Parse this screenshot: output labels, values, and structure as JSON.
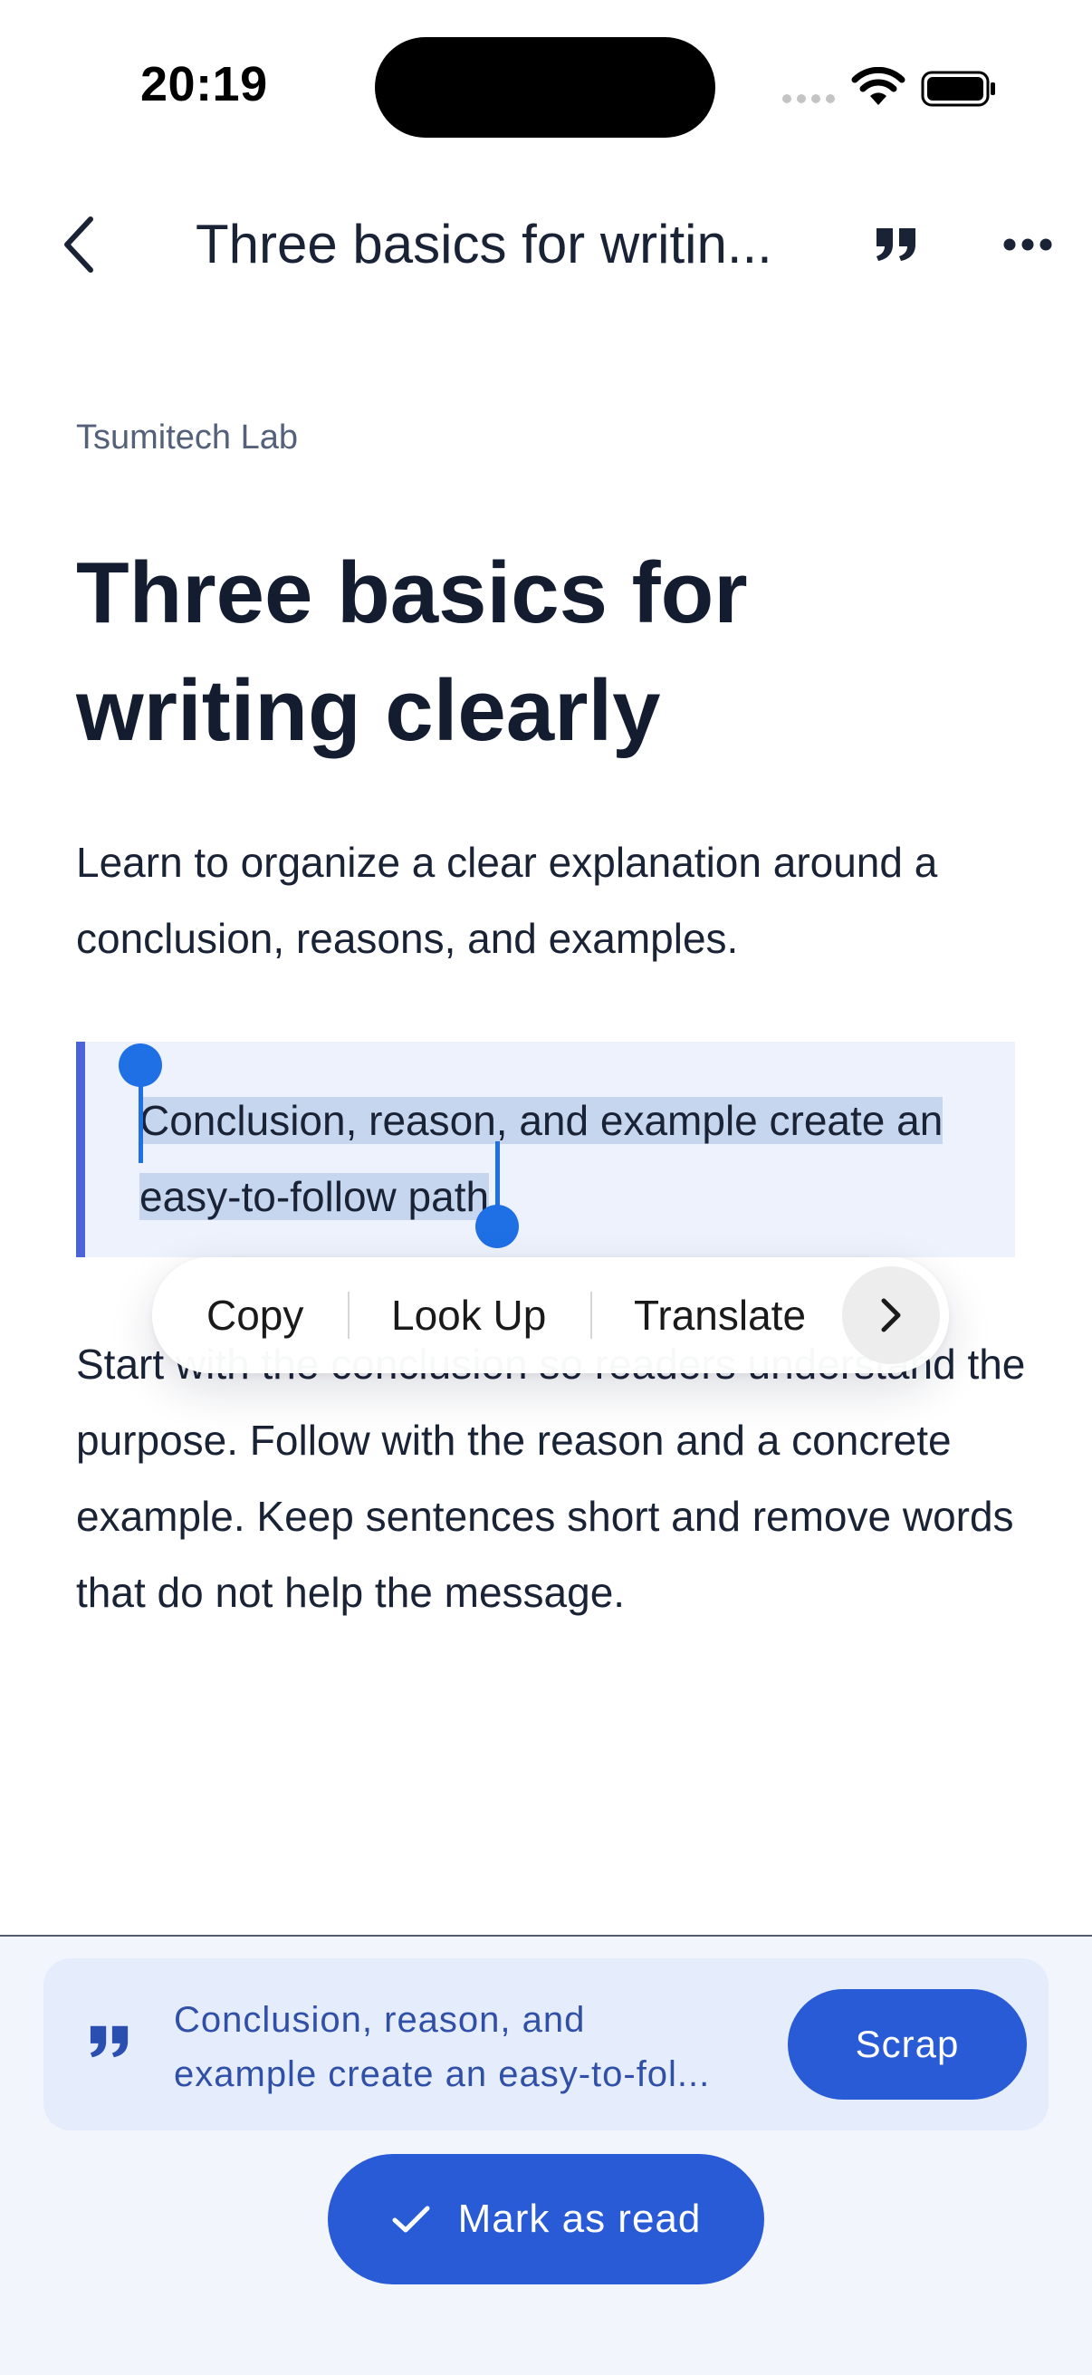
{
  "status_bar": {
    "time": "20:19"
  },
  "nav": {
    "title": "Three basics for writin..."
  },
  "article": {
    "publisher": "Tsumitech Lab",
    "title": "Three basics for writing clearly",
    "lead": "Learn to organize a clear explanation around a conclusion, reasons, and examples.",
    "quote_line1": "Conclusion, reason, and example create an",
    "quote_line2": "easy-to-follow path",
    "quote_period": ".",
    "body": "Start with the conclusion so readers understand the purpose. Follow with the reason and a concrete example. Keep sentences short and remove words that do not help the message."
  },
  "context_menu": {
    "copy": "Copy",
    "look_up": "Look Up",
    "translate": "Translate"
  },
  "scrap_panel": {
    "excerpt_line1": "Conclusion, reason, and",
    "excerpt_line2": "example create an easy-to-fol...",
    "scrap_label": "Scrap",
    "mark_read_label": "Mark as read"
  },
  "icons": {
    "back": "chevron-left-icon",
    "quote": "quote-icon",
    "more": "more-horizontal-icon",
    "next": "chevron-right-icon",
    "check": "checkmark-icon"
  },
  "colors": {
    "accent": "#2a5bd7",
    "selection": "#c7d6ef",
    "handle": "#1f6fe5",
    "quote_border": "#4a63d6",
    "quote_bg": "#eef2fc"
  }
}
